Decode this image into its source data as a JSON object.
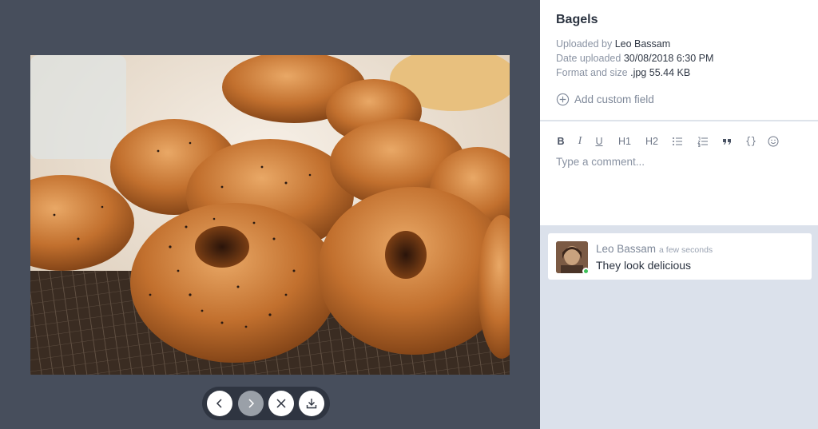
{
  "file": {
    "title": "Bagels",
    "uploaded_by_label": "Uploaded by",
    "uploaded_by": "Leo Bassam",
    "date_label": "Date uploaded",
    "date": "30/08/2018 6:30 PM",
    "format_label": "Format and size",
    "format": ".jpg 55.44 KB",
    "add_field_label": "Add custom field"
  },
  "editor": {
    "placeholder": "Type a comment...",
    "toolbar": [
      "B",
      "I",
      "U",
      "H1",
      "H2",
      "bullet-list-icon",
      "numbered-list-icon",
      "quote-icon",
      "{}",
      "emoji-icon"
    ]
  },
  "comments": [
    {
      "author": "Leo Bassam",
      "time": "a few seconds",
      "text": "They look delicious",
      "online": true
    }
  ],
  "viewer": {
    "controls": [
      "chevron-left-icon",
      "chevron-right-icon",
      "close-icon",
      "download-icon"
    ],
    "next_disabled": true
  },
  "colors": {
    "viewer_bg": "#474e5c",
    "panel_bg": "#dbe1eb",
    "online": "#3ec15a"
  }
}
